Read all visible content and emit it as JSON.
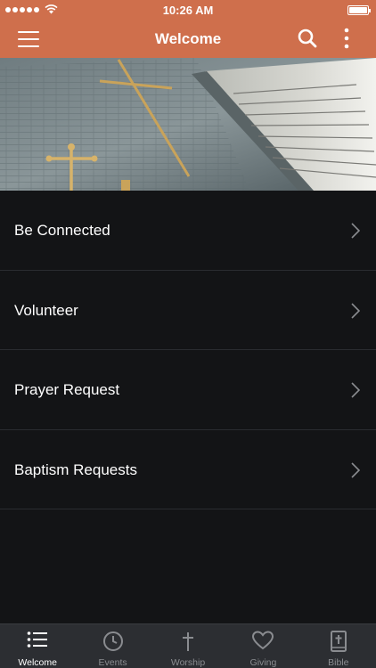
{
  "status_bar": {
    "time": "10:26 AM"
  },
  "navbar": {
    "title": "Welcome",
    "icons": [
      "menu-icon",
      "search-icon",
      "more-vertical-icon"
    ]
  },
  "hero": {
    "description_icon": "church-hero-image"
  },
  "list": {
    "items": [
      {
        "label": "Be Connected"
      },
      {
        "label": "Volunteer"
      },
      {
        "label": "Prayer Request"
      },
      {
        "label": "Baptism Requests"
      }
    ]
  },
  "tabbar": {
    "tabs": [
      {
        "label": "Welcome",
        "icon": "list-icon",
        "active": true
      },
      {
        "label": "Events",
        "icon": "clock-icon",
        "active": false
      },
      {
        "label": "Worship",
        "icon": "cross-icon",
        "active": false
      },
      {
        "label": "Giving",
        "icon": "heart-icon",
        "active": false
      },
      {
        "label": "Bible",
        "icon": "bible-icon",
        "active": false
      }
    ]
  },
  "colors": {
    "accent": "#cf6f4c",
    "background": "#131416",
    "tabbar": "#2c2e32"
  }
}
